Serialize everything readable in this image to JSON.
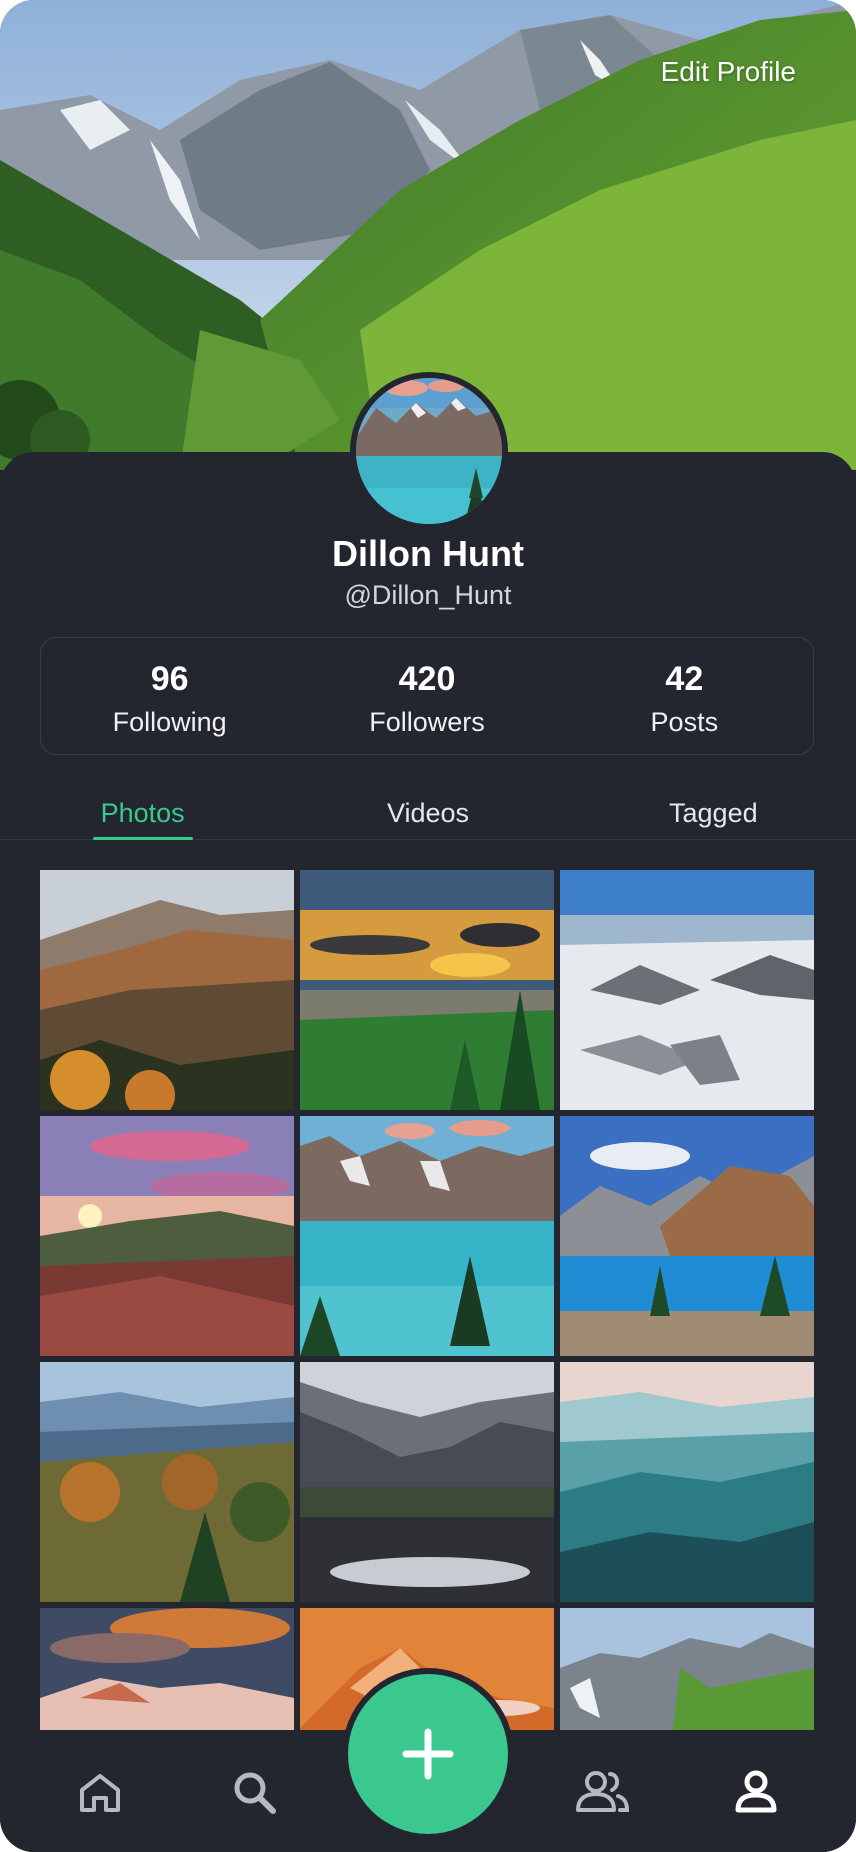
{
  "header": {
    "edit_profile_label": "Edit Profile"
  },
  "profile": {
    "name": "Dillon Hunt",
    "handle": "@Dillon_Hunt"
  },
  "stats": [
    {
      "value": "96",
      "label": "Following"
    },
    {
      "value": "420",
      "label": "Followers"
    },
    {
      "value": "42",
      "label": "Posts"
    }
  ],
  "tabs": [
    {
      "label": "Photos",
      "active": true
    },
    {
      "label": "Videos",
      "active": false
    },
    {
      "label": "Tagged",
      "active": false
    }
  ],
  "nav": {
    "items": [
      "home-icon",
      "search-icon",
      "add-icon",
      "friends-icon",
      "profile-icon"
    ],
    "active": "profile-icon"
  },
  "colors": {
    "accent": "#39c98e",
    "background": "#24262f",
    "fab": "#3ac88f"
  }
}
